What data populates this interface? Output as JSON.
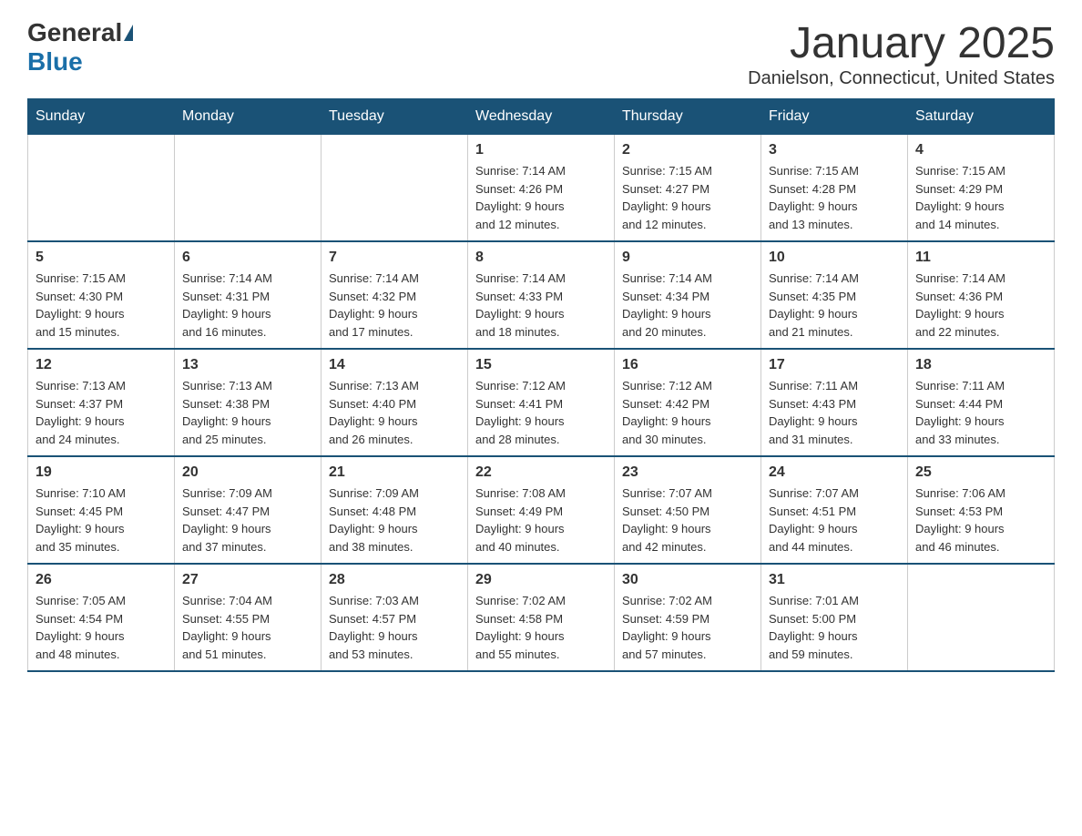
{
  "logo": {
    "general": "General",
    "blue": "Blue"
  },
  "header": {
    "month_title": "January 2025",
    "location": "Danielson, Connecticut, United States"
  },
  "weekdays": [
    "Sunday",
    "Monday",
    "Tuesday",
    "Wednesday",
    "Thursday",
    "Friday",
    "Saturday"
  ],
  "weeks": [
    [
      {
        "day": "",
        "info": ""
      },
      {
        "day": "",
        "info": ""
      },
      {
        "day": "",
        "info": ""
      },
      {
        "day": "1",
        "info": "Sunrise: 7:14 AM\nSunset: 4:26 PM\nDaylight: 9 hours\nand 12 minutes."
      },
      {
        "day": "2",
        "info": "Sunrise: 7:15 AM\nSunset: 4:27 PM\nDaylight: 9 hours\nand 12 minutes."
      },
      {
        "day": "3",
        "info": "Sunrise: 7:15 AM\nSunset: 4:28 PM\nDaylight: 9 hours\nand 13 minutes."
      },
      {
        "day": "4",
        "info": "Sunrise: 7:15 AM\nSunset: 4:29 PM\nDaylight: 9 hours\nand 14 minutes."
      }
    ],
    [
      {
        "day": "5",
        "info": "Sunrise: 7:15 AM\nSunset: 4:30 PM\nDaylight: 9 hours\nand 15 minutes."
      },
      {
        "day": "6",
        "info": "Sunrise: 7:14 AM\nSunset: 4:31 PM\nDaylight: 9 hours\nand 16 minutes."
      },
      {
        "day": "7",
        "info": "Sunrise: 7:14 AM\nSunset: 4:32 PM\nDaylight: 9 hours\nand 17 minutes."
      },
      {
        "day": "8",
        "info": "Sunrise: 7:14 AM\nSunset: 4:33 PM\nDaylight: 9 hours\nand 18 minutes."
      },
      {
        "day": "9",
        "info": "Sunrise: 7:14 AM\nSunset: 4:34 PM\nDaylight: 9 hours\nand 20 minutes."
      },
      {
        "day": "10",
        "info": "Sunrise: 7:14 AM\nSunset: 4:35 PM\nDaylight: 9 hours\nand 21 minutes."
      },
      {
        "day": "11",
        "info": "Sunrise: 7:14 AM\nSunset: 4:36 PM\nDaylight: 9 hours\nand 22 minutes."
      }
    ],
    [
      {
        "day": "12",
        "info": "Sunrise: 7:13 AM\nSunset: 4:37 PM\nDaylight: 9 hours\nand 24 minutes."
      },
      {
        "day": "13",
        "info": "Sunrise: 7:13 AM\nSunset: 4:38 PM\nDaylight: 9 hours\nand 25 minutes."
      },
      {
        "day": "14",
        "info": "Sunrise: 7:13 AM\nSunset: 4:40 PM\nDaylight: 9 hours\nand 26 minutes."
      },
      {
        "day": "15",
        "info": "Sunrise: 7:12 AM\nSunset: 4:41 PM\nDaylight: 9 hours\nand 28 minutes."
      },
      {
        "day": "16",
        "info": "Sunrise: 7:12 AM\nSunset: 4:42 PM\nDaylight: 9 hours\nand 30 minutes."
      },
      {
        "day": "17",
        "info": "Sunrise: 7:11 AM\nSunset: 4:43 PM\nDaylight: 9 hours\nand 31 minutes."
      },
      {
        "day": "18",
        "info": "Sunrise: 7:11 AM\nSunset: 4:44 PM\nDaylight: 9 hours\nand 33 minutes."
      }
    ],
    [
      {
        "day": "19",
        "info": "Sunrise: 7:10 AM\nSunset: 4:45 PM\nDaylight: 9 hours\nand 35 minutes."
      },
      {
        "day": "20",
        "info": "Sunrise: 7:09 AM\nSunset: 4:47 PM\nDaylight: 9 hours\nand 37 minutes."
      },
      {
        "day": "21",
        "info": "Sunrise: 7:09 AM\nSunset: 4:48 PM\nDaylight: 9 hours\nand 38 minutes."
      },
      {
        "day": "22",
        "info": "Sunrise: 7:08 AM\nSunset: 4:49 PM\nDaylight: 9 hours\nand 40 minutes."
      },
      {
        "day": "23",
        "info": "Sunrise: 7:07 AM\nSunset: 4:50 PM\nDaylight: 9 hours\nand 42 minutes."
      },
      {
        "day": "24",
        "info": "Sunrise: 7:07 AM\nSunset: 4:51 PM\nDaylight: 9 hours\nand 44 minutes."
      },
      {
        "day": "25",
        "info": "Sunrise: 7:06 AM\nSunset: 4:53 PM\nDaylight: 9 hours\nand 46 minutes."
      }
    ],
    [
      {
        "day": "26",
        "info": "Sunrise: 7:05 AM\nSunset: 4:54 PM\nDaylight: 9 hours\nand 48 minutes."
      },
      {
        "day": "27",
        "info": "Sunrise: 7:04 AM\nSunset: 4:55 PM\nDaylight: 9 hours\nand 51 minutes."
      },
      {
        "day": "28",
        "info": "Sunrise: 7:03 AM\nSunset: 4:57 PM\nDaylight: 9 hours\nand 53 minutes."
      },
      {
        "day": "29",
        "info": "Sunrise: 7:02 AM\nSunset: 4:58 PM\nDaylight: 9 hours\nand 55 minutes."
      },
      {
        "day": "30",
        "info": "Sunrise: 7:02 AM\nSunset: 4:59 PM\nDaylight: 9 hours\nand 57 minutes."
      },
      {
        "day": "31",
        "info": "Sunrise: 7:01 AM\nSunset: 5:00 PM\nDaylight: 9 hours\nand 59 minutes."
      },
      {
        "day": "",
        "info": ""
      }
    ]
  ]
}
